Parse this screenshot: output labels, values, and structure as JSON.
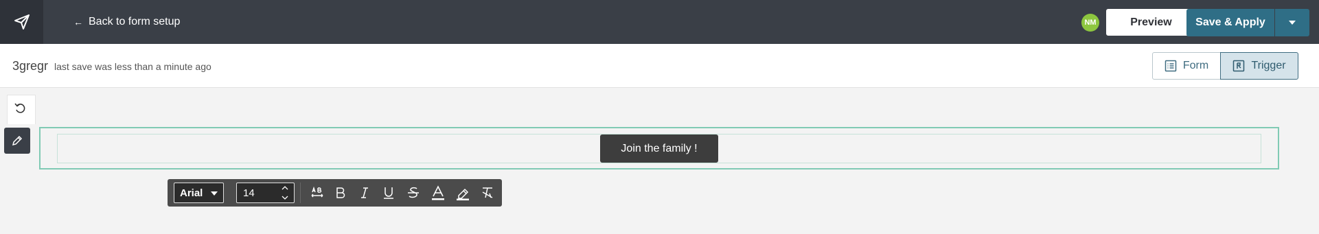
{
  "header": {
    "back_label": "Back to form setup",
    "back_arrow": "←",
    "avatar_initials": "NM",
    "preview_label": "Preview",
    "save_label": "Save & Apply"
  },
  "subheader": {
    "form_name": "3gregr",
    "save_status": "last save was less than a minute ago",
    "form_toggle_label": "Form",
    "trigger_toggle_label": "Trigger",
    "active_toggle": "Trigger"
  },
  "canvas": {
    "button_label": "Join the family !"
  },
  "text_toolbar": {
    "font_family": "Arial",
    "font_size": "14",
    "tools": [
      "letter-spacing-icon",
      "bold-icon",
      "italic-icon",
      "underline-icon",
      "strikethrough-icon",
      "text-color-icon",
      "highlight-icon",
      "clear-format-icon"
    ]
  },
  "colors": {
    "topbar": "#3a3f47",
    "primary": "#2f6e86",
    "avatar": "#8dc63f",
    "section_border": "#80cab4"
  }
}
